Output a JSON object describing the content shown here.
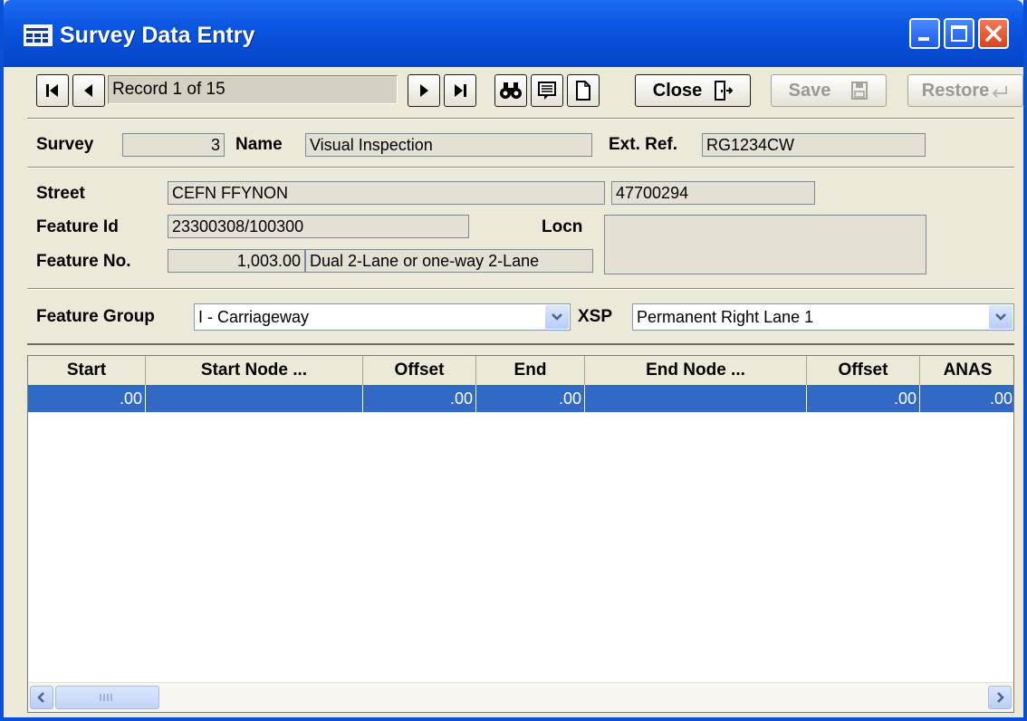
{
  "window": {
    "title": "Survey Data Entry"
  },
  "toolbar": {
    "record": "Record 1 of 15",
    "close_label": "Close",
    "save_label": "Save",
    "restore_label": "Restore"
  },
  "survey": {
    "survey_label": "Survey",
    "survey_value": "3",
    "name_label": "Name",
    "name_value": "Visual Inspection",
    "extref_label": "Ext. Ref.",
    "extref_value": "RG1234CW"
  },
  "feature": {
    "street_label": "Street",
    "street_value": "CEFN FFYNON",
    "street_code": "47700294",
    "id_label": "Feature Id",
    "id_value": "23300308/100300",
    "locn_label": "Locn",
    "locn_value": "",
    "no_label": "Feature No.",
    "no_value": "1,003.00",
    "no_desc": "Dual 2-Lane or one-way 2-Lane"
  },
  "selectors": {
    "group_label": "Feature Group",
    "group_value": "I - Carriageway",
    "xsp_label": "XSP",
    "xsp_value": "Permanent Right Lane 1"
  },
  "grid": {
    "columns": [
      "Start",
      "Start Node ...",
      "Offset",
      "End",
      "End Node ...",
      "Offset",
      "ANAS"
    ],
    "rows": [
      [
        ".00",
        "",
        ".00",
        ".00",
        "",
        ".00",
        ".00"
      ]
    ]
  },
  "colors": {
    "titlebar": "#0a55e0",
    "selection": "#316ac5",
    "face": "#ece9d8"
  }
}
